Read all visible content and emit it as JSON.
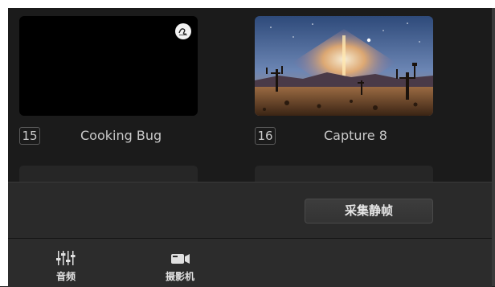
{
  "media": {
    "items": [
      {
        "number": "15",
        "title": "Cooking Bug"
      },
      {
        "number": "16",
        "title": "Capture 8"
      }
    ]
  },
  "actions": {
    "capture_still_label": "采集静帧"
  },
  "bottom_tabs": [
    {
      "label": "音频",
      "icon": "audio-mixer-icon"
    },
    {
      "label": "摄影机",
      "icon": "camera-icon"
    }
  ],
  "colors": {
    "background": "#1f1f1f",
    "text": "#c9c9c9",
    "button": "#383838"
  }
}
